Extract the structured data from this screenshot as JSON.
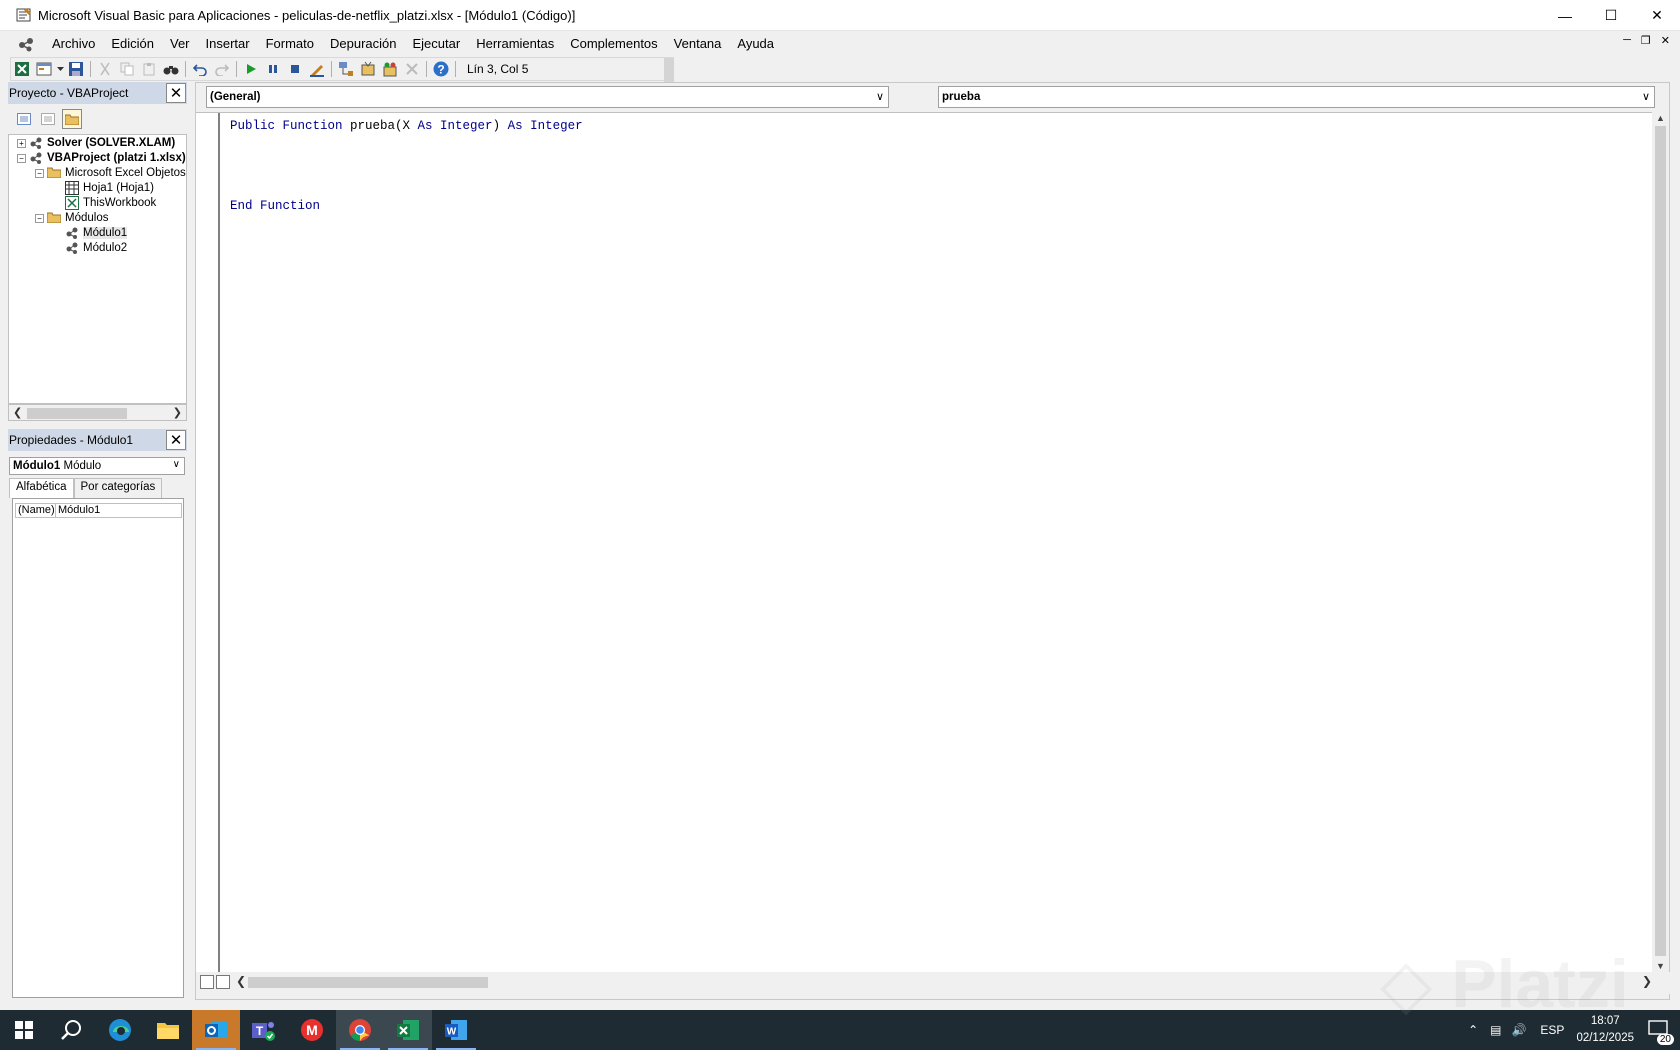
{
  "window": {
    "title": "Microsoft Visual Basic para Aplicaciones - peliculas-de-netflix_platzi.xlsx - [Módulo1 (Código)]",
    "minimize_icon": "minimize-icon",
    "maximize_icon": "maximize-icon",
    "close_icon": "close-icon"
  },
  "menu": {
    "items": [
      {
        "label": "Archivo",
        "accel": "A"
      },
      {
        "label": "Edición",
        "accel": "E"
      },
      {
        "label": "Ver",
        "accel": "V"
      },
      {
        "label": "Insertar",
        "accel": "I"
      },
      {
        "label": "Formato",
        "accel": "F"
      },
      {
        "label": "Depuración",
        "accel": "D"
      },
      {
        "label": "Ejecutar",
        "accel": "E"
      },
      {
        "label": "Herramientas",
        "accel": "H"
      },
      {
        "label": "Complementos",
        "accel": "C"
      },
      {
        "label": "Ventana",
        "accel": "n"
      },
      {
        "label": "Ayuda",
        "accel": "y"
      }
    ]
  },
  "toolbar": {
    "status": "Lín 3, Col 5"
  },
  "project": {
    "title": "Proyecto - VBAProject",
    "tree": [
      {
        "label": "Solver (SOLVER.XLAM)",
        "bold": true
      },
      {
        "label": "VBAProject (platzi 1.xlsx)",
        "bold": true
      },
      {
        "label": "Microsoft Excel Objetos"
      },
      {
        "label": "Hoja1 (Hoja1)"
      },
      {
        "label": "ThisWorkbook"
      },
      {
        "label": "Módulos"
      },
      {
        "label": "Módulo1"
      },
      {
        "label": "Módulo2"
      }
    ]
  },
  "properties": {
    "title": "Propiedades - Módulo1",
    "object_name": "Módulo1",
    "object_type": "Módulo",
    "tabs": [
      "Alfabética",
      "Por categorías"
    ],
    "rows": [
      {
        "key": "(Name)",
        "value": "Módulo1"
      }
    ]
  },
  "code": {
    "object_combo": "(General)",
    "proc_combo": "prueba",
    "lines": {
      "l1_kw1": "Public Function",
      "l1_name": " prueba(X ",
      "l1_kw2": "As Integer",
      "l1_mid": ") ",
      "l1_kw3": "As Integer",
      "l4": "End Function"
    }
  },
  "taskbar": {
    "apps": [
      "windows-start-icon",
      "search-icon",
      "edge-icon",
      "file-explorer-icon",
      "outlook-icon",
      "teams-icon",
      "gmail-icon",
      "chrome-icon",
      "excel-icon",
      "word-icon"
    ],
    "language": "ESP",
    "time": "18:07",
    "date": "02/12/2025",
    "notifications": "20"
  },
  "colors": {
    "keyword": "#00008b",
    "panel_header": "#cfd8e6",
    "taskbar": "#1f2b33"
  }
}
